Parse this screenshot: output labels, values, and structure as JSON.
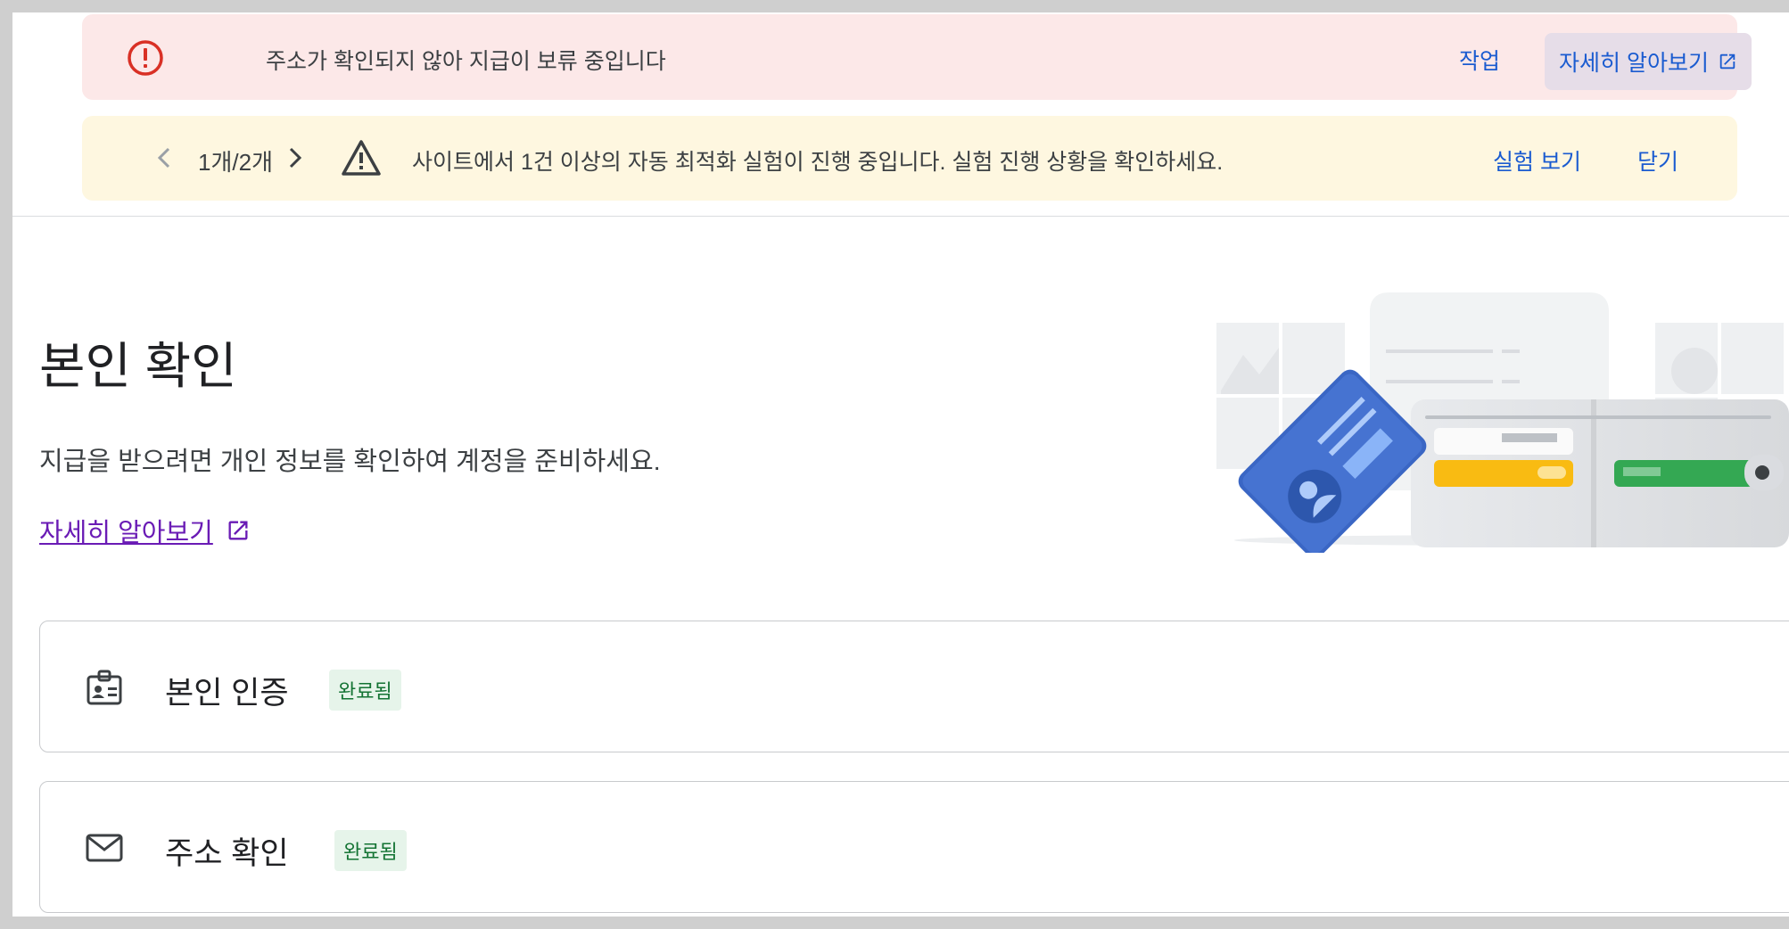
{
  "banners": {
    "error": {
      "icon": "error-circle-icon",
      "message": "주소가 확인되지 않아 지급이 보류 중입니다",
      "action_label": "작업",
      "learn_more_label": "자세히 알아보기",
      "color": "#fce8e8"
    },
    "warning": {
      "pager": "1개/2개",
      "icon": "warning-triangle-icon",
      "message": "사이트에서 1건 이상의 자동 최적화 실험이 진행 중입니다. 실험 진행 상황을 확인하세요.",
      "view_label": "실험 보기",
      "close_label": "닫기",
      "color": "#fef7e0"
    }
  },
  "page": {
    "title": "본인 확인",
    "description": "지급을 받으려면 개인 정보를 확인하여 계정을 준비하세요.",
    "learn_more_label": "자세히 알아보기"
  },
  "cards": [
    {
      "icon": "id-badge-icon",
      "title": "본인 인증",
      "status": "완료됨"
    },
    {
      "icon": "mail-icon",
      "title": "주소 확인",
      "status": "완료됨"
    }
  ],
  "colors": {
    "link": "#1a5bd0",
    "visited_link": "#6a1bb5",
    "error": "#d93025",
    "success_bg": "#e6f4ea",
    "success_text": "#137333"
  }
}
